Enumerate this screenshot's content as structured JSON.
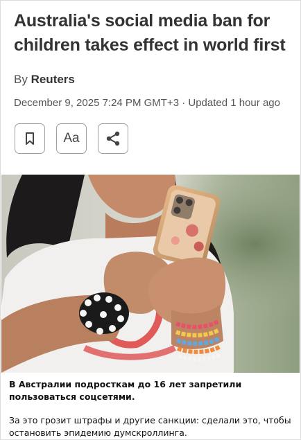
{
  "article": {
    "headline": "Australia's social media ban for children takes effect in world first",
    "by_prefix": "By",
    "author": "Reuters",
    "dateline": "December 9, 2025 7:24 PM GMT+3 · Updated 1 hour ago"
  },
  "toolbar": {
    "bookmark_icon": "bookmark-icon",
    "text_size_label": "Aa",
    "share_icon": "share-icon"
  },
  "photo": {
    "subject": "girl-holding-phone"
  },
  "caption": {
    "bold": "В Австралии подросткам до 16 лет запретили пользоваться соцсетями.",
    "text": "За это грозит штрафы и другие санкции: сделали это, чтобы остановить эпидемию думскроллинга."
  },
  "colors": {
    "text": "#333333",
    "muted": "#555555",
    "button_border": "#9e9e9e"
  }
}
